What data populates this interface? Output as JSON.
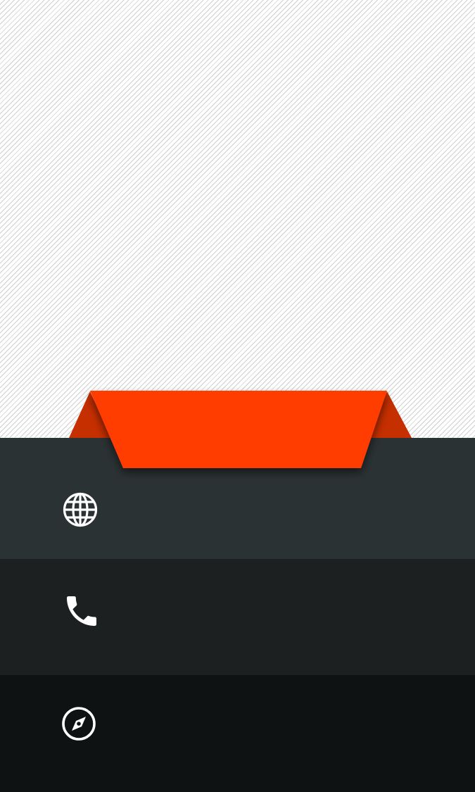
{
  "header": {
    "pattern": "diagonal-stripes",
    "background_color": "#ffffff",
    "stripe_color": "#cfcfcf"
  },
  "ribbon": {
    "color": "#ff3d00",
    "fold_color": "#c62f00",
    "label": ""
  },
  "rows": [
    {
      "icon": "globe-icon",
      "color": "#2b3234"
    },
    {
      "icon": "phone-icon",
      "color": "#1c2021"
    },
    {
      "icon": "compass-icon",
      "color": "#0e1213"
    }
  ]
}
